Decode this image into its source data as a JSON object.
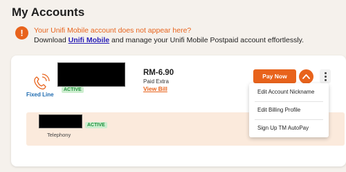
{
  "page": {
    "title": "My Accounts"
  },
  "notice": {
    "headline": "Your Unifi Mobile account does not appear here?",
    "text_before": "Download ",
    "link": "Unifi Mobile",
    "text_after": " and manage your Unifi Mobile Postpaid account effortlessly.",
    "icon": "exclamation-icon"
  },
  "account": {
    "line_type": "Fixed Line",
    "status": "ACTIVE",
    "amount": "RM-6.90",
    "amount_note": "Paid Extra",
    "view_bill": "View Bill",
    "pay_button": "Pay Now",
    "services": [
      {
        "status": "ACTIVE",
        "label": "Telephony"
      }
    ]
  },
  "menu": {
    "items": [
      {
        "label": "Edit Account Nickname"
      },
      {
        "label": "Edit Billing Profile"
      },
      {
        "label": "Sign Up TM AutoPay"
      }
    ]
  },
  "colors": {
    "accent": "#e8631c",
    "link": "#2a20b8",
    "active_badge": "#cdeecf",
    "fixed_line": "#1e6bb0"
  }
}
